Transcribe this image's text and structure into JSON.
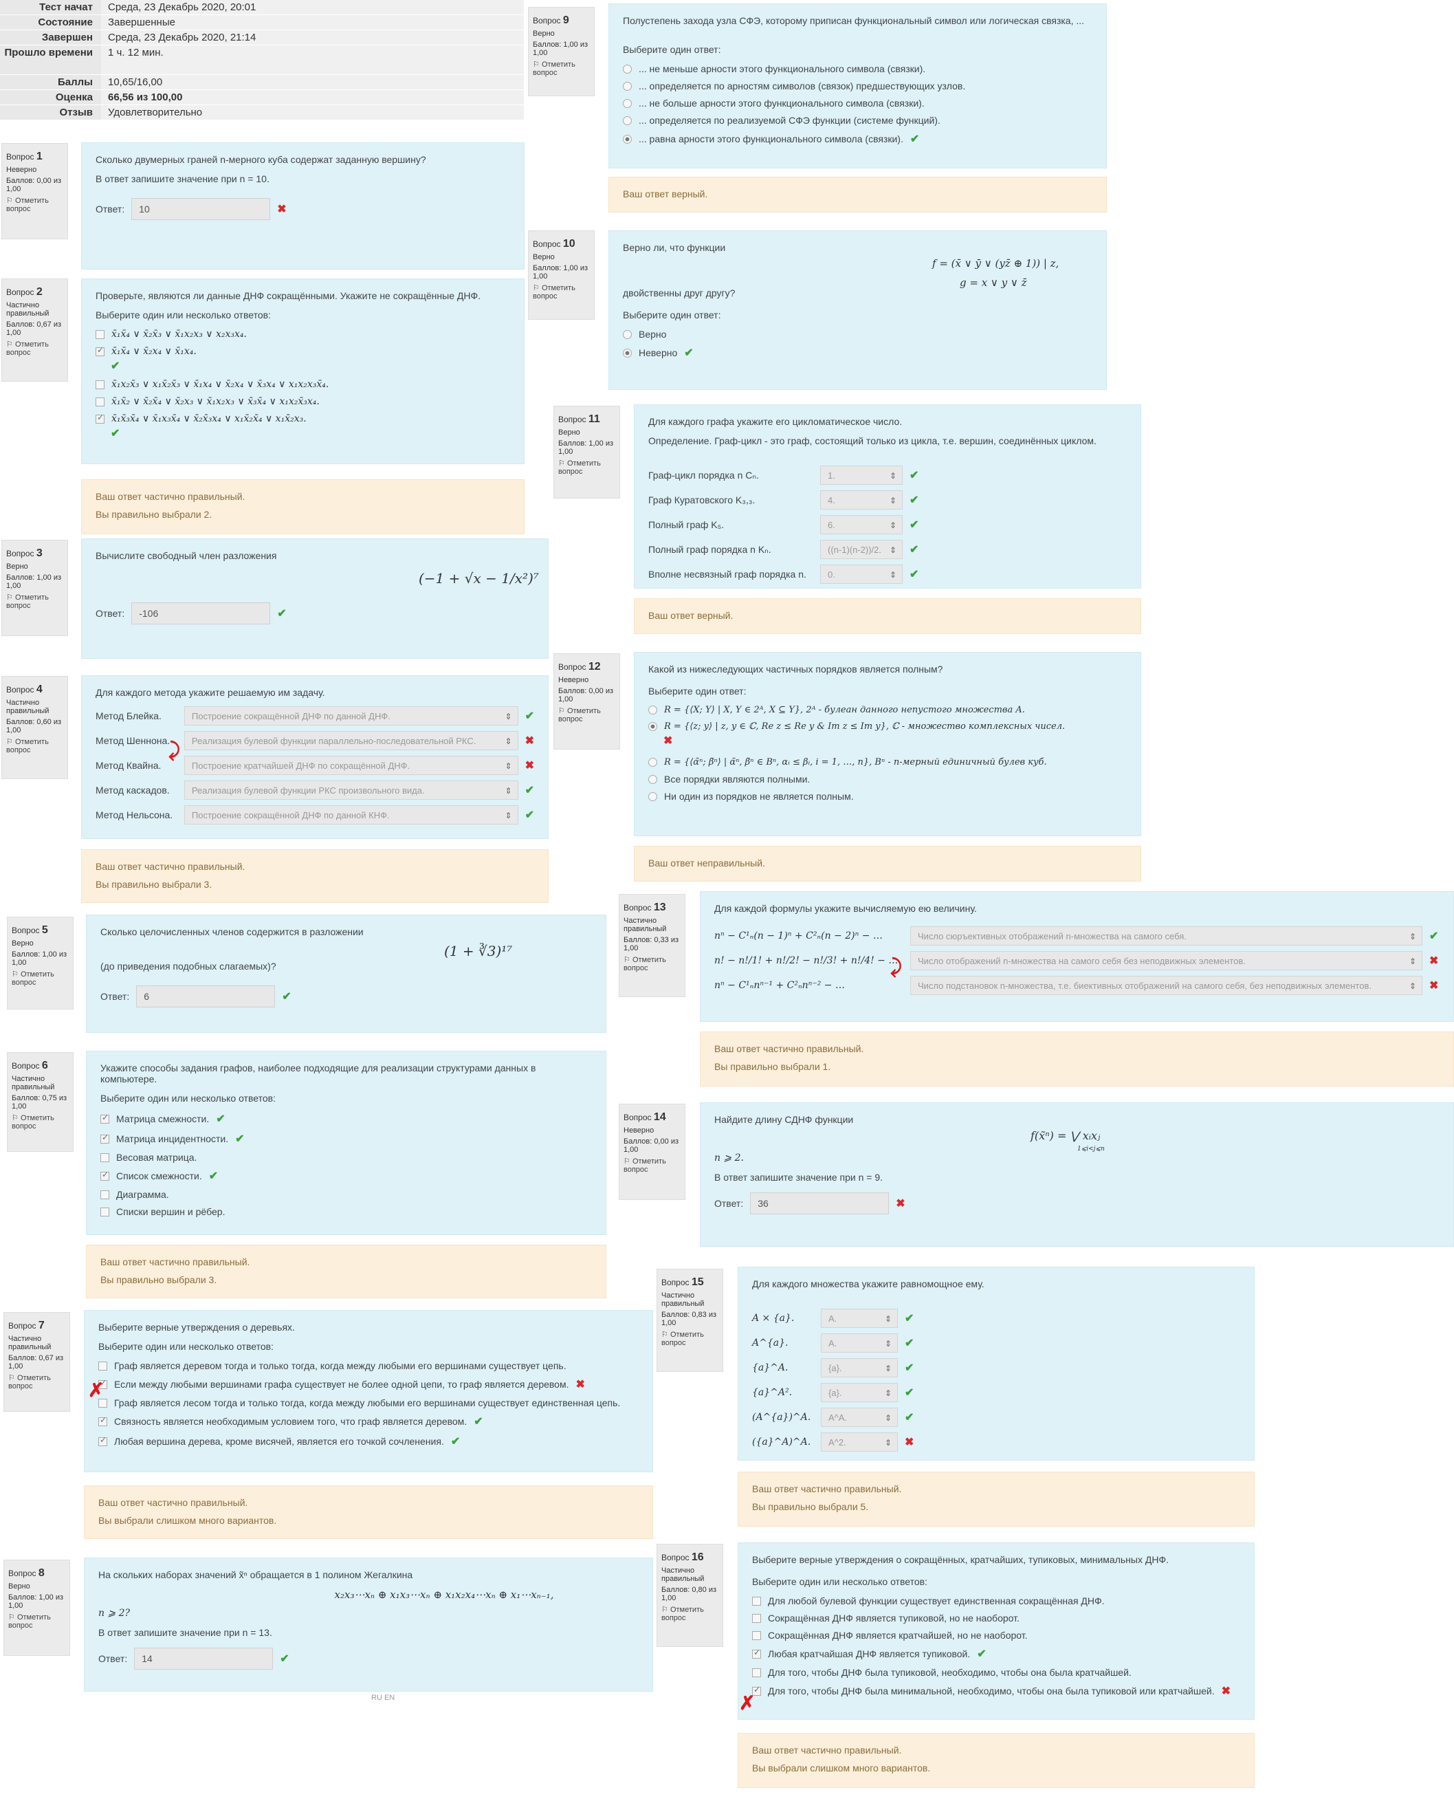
{
  "summary": [
    {
      "k": "Тест начат",
      "v": "Среда, 23 Декабрь 2020, 20:01"
    },
    {
      "k": "Состояние",
      "v": "Завершенные"
    },
    {
      "k": "Завершен",
      "v": "Среда, 23 Декабрь 2020, 21:14"
    },
    {
      "k": "Прошло времени",
      "v": "1 ч. 12 мин."
    },
    {
      "k": "Баллы",
      "v": "10,65/16,00"
    },
    {
      "k": "Оценка",
      "v": "66,56 из 100,00"
    },
    {
      "k": "Отзыв",
      "v": "Удовлетворительно"
    }
  ],
  "flag_label": "Отметить вопрос",
  "answer_label": "Ответ:",
  "choose_one": "Выберите один ответ:",
  "choose_many": "Выберите один или несколько ответов:",
  "questions": {
    "q1": {
      "no": "1",
      "state": "Неверно",
      "score": "Баллов: 0,00 из 1,00",
      "text": "Сколько двумерных граней n-мерного куба содержат заданную вершину?",
      "text2": "В ответ запишите значение при n = 10.",
      "answer": "10"
    },
    "q2": {
      "no": "2",
      "state": "Частично правильный",
      "score": "Баллов: 0,67 из 1,00",
      "text": "Проверьте, являются ли данные ДНФ сокращёнными. Укажите не сокращённые ДНФ.",
      "options": [
        "x̄₁x̄₄ ∨ x̄₂x̄₃ ∨ x̄₁x₂x₃ ∨ x₂x₃x₄.",
        "x̄₁x̄₄ ∨ x̄₂x₄ ∨ x̄₁x₄.",
        "x̄₁x₂x̄₃ ∨ x₁x̄₂x̄₃ ∨ x̄₁x₄ ∨ x̄₂x₄ ∨ x̄₃x₄ ∨ x₁x₂x₃x̄₄.",
        "x̄₁x̄₂ ∨ x̄₂x̄₄ ∨ x̄₂x₃ ∨ x̄₁x₂x₃ ∨ x̄₃x̄₄ ∨ x₁x₂x̄₃x₄.",
        "x̄₁x̄₃x̄₄ ∨ x̄₁x₃x̄₄ ∨ x̄₂x̄₃x₄ ∨ x₁x̄₂x̄₄ ∨ x₁x̄₂x₃."
      ],
      "fb1": "Ваш ответ частично правильный.",
      "fb2": "Вы правильно выбрали 2."
    },
    "q3": {
      "no": "3",
      "state": "Верно",
      "score": "Баллов: 1,00 из 1,00",
      "text": "Вычислите свободный член разложения",
      "formula": "(−1 + √x − 1/x²)⁷",
      "answer": "-106"
    },
    "q4": {
      "no": "4",
      "state": "Частично правильный",
      "score": "Баллов: 0,60 из 1,00",
      "text": "Для каждого метода укажите решаемую им задачу.",
      "rows": [
        {
          "label": "Метод Блейка.",
          "value": "Построение сокращённой ДНФ по данной ДНФ.",
          "ok": true
        },
        {
          "label": "Метод Шеннона.",
          "value": "Реализация булевой функции параллельно-последовательной РКС.",
          "ok": false
        },
        {
          "label": "Метод Квайна.",
          "value": "Построение кратчайшей ДНФ по сокращённой ДНФ.",
          "ok": false
        },
        {
          "label": "Метод каскадов.",
          "value": "Реализация булевой функции РКС произвольного вида.",
          "ok": true
        },
        {
          "label": "Метод Нельсона.",
          "value": "Построение сокращённой ДНФ по данной КНФ.",
          "ok": true
        }
      ],
      "fb1": "Ваш ответ частично правильный.",
      "fb2": "Вы правильно выбрали 3."
    },
    "q5": {
      "no": "5",
      "state": "Верно",
      "score": "Баллов: 1,00 из 1,00",
      "text": "Сколько целочисленных членов содержится в разложении",
      "formula": "(1 + ∛3)¹⁷",
      "text2": "(до приведения подобных слагаемых)?",
      "answer": "6"
    },
    "q6": {
      "no": "6",
      "state": "Частично правильный",
      "score": "Баллов: 0,75 из 1,00",
      "text": "Укажите способы задания графов, наиболее подходящие для реализации структурами данных в компьютере.",
      "options": [
        "Матрица смежности.",
        "Матрица инцидентности.",
        "Весовая матрица.",
        "Список смежности.",
        "Диаграмма.",
        "Списки вершин и рёбер."
      ],
      "fb1": "Ваш ответ частично правильный.",
      "fb2": "Вы правильно выбрали 3."
    },
    "q7": {
      "no": "7",
      "state": "Частично правильный",
      "score": "Баллов: 0,67 из 1,00",
      "text": "Выберите верные утверждения о деревьях.",
      "options": [
        "Граф является деревом тогда и только тогда, когда между любыми его вершинами существует цепь.",
        "Если между любыми вершинами графа существует не более одной цепи, то граф является деревом.",
        "Граф является лесом тогда и только тогда, когда между любыми его вершинами существует единственная цепь.",
        "Связность является необходимым условием того, что граф является деревом.",
        "Любая вершина дерева, кроме висячей, является его точкой сочленения."
      ],
      "fb1": "Ваш ответ частично правильный.",
      "fb2": "Вы выбрали слишком много вариантов."
    },
    "q8": {
      "no": "8",
      "state": "Верно",
      "score": "Баллов: 1,00 из 1,00",
      "text": "На скольких наборах значений x̃ⁿ обращается в 1 полином Жегалкина",
      "formula": "x₂x₃⋯xₙ ⊕ x₁x₃⋯xₙ ⊕ x₁x₂x₄⋯xₙ ⊕ x₁⋯xₙ₋₁,",
      "text2": "n ⩾ 2?",
      "text3": "В ответ запишите значение при n = 13.",
      "answer": "14"
    },
    "q9": {
      "no": "9",
      "state": "Верно",
      "score": "Баллов: 1,00 из 1,00",
      "text": "Полустепень захода узла СФЭ, которому приписан функциональный символ или логическая связка, ...",
      "options": [
        "... не меньше арности этого функционального символа (связки).",
        "... определяется по арностям символов (связок) предшествующих узлов.",
        "... не больше арности этого функционального символа (связки).",
        "... определяется по реализуемой СФЭ функции (системе функций).",
        "... равна арности этого функционального символа (связки)."
      ],
      "fb1": "Ваш ответ верный."
    },
    "q10": {
      "no": "10",
      "state": "Верно",
      "score": "Баллов: 1,00 из 1,00",
      "text": "Верно ли, что функции",
      "f1": "f = (x̄ ∨ ȳ ∨ (yz̄ ⊕ 1)) | z,",
      "f2": "g = x ∨ y ∨ z̄",
      "text2": "двойственны друг другу?",
      "options": [
        "Верно",
        "Неверно"
      ]
    },
    "q11": {
      "no": "11",
      "state": "Верно",
      "score": "Баллов: 1,00 из 1,00",
      "text": "Для каждого графа укажите его цикломатическое число.",
      "text2": "Определение. Граф-цикл - это граф, состоящий только из цикла, т.е. вершин, соединённых циклом.",
      "rows": [
        {
          "label": "Граф-цикл порядка n Cₙ.",
          "value": "1."
        },
        {
          "label": "Граф Куратовского K₃,₃.",
          "value": "4."
        },
        {
          "label": "Полный граф K₅.",
          "value": "6."
        },
        {
          "label": "Полный граф порядка n Kₙ.",
          "value": "((n-1)(n-2))/2."
        },
        {
          "label": "Вполне несвязный граф порядка n.",
          "value": "0."
        }
      ],
      "fb1": "Ваш ответ верный."
    },
    "q12": {
      "no": "12",
      "state": "Неверно",
      "score": "Баллов: 0,00 из 1,00",
      "text": "Какой из нижеследующих частичных порядков является полным?",
      "options": [
        "R = {⟨X; Y⟩ | X, Y ∈ 2ᴬ, X ⊆ Y}, 2ᴬ - булеан данного непустого множества A.",
        "R = {⟨z; y⟩ | z, y ∈ ℂ, Re z ≤ Re y & Im z ≤ Im y}, ℂ - множество комплексных чисел.",
        "R = {⟨α̃ⁿ; β̃ⁿ⟩ | α̃ⁿ, β̃ⁿ ∈ Bⁿ, αᵢ ≤ βᵢ, i = 1, …, n}, Bⁿ - n-мерный единичный булев куб.",
        "Все порядки являются полными.",
        "Ни один из порядков не является полным."
      ],
      "fb1": "Ваш ответ неправильный."
    },
    "q13": {
      "no": "13",
      "state": "Частично правильный",
      "score": "Баллов: 0,33 из 1,00",
      "text": "Для каждой формулы укажите вычисляемую ею величину.",
      "rows": [
        {
          "label": "nⁿ − C¹ₙ(n − 1)ⁿ + C²ₙ(n − 2)ⁿ − …",
          "value": "Число сюръективных отображений n-множества на самого себя.",
          "ok": true
        },
        {
          "label": "n! − n!/1! + n!/2! − n!/3! + n!/4! − …",
          "value": "Число отображений n-множества на самого себя без неподвижных элементов.",
          "ok": false
        },
        {
          "label": "nⁿ − C¹ₙnⁿ⁻¹ + C²ₙnⁿ⁻² − …",
          "value": "Число подстановок n-множества, т.е. биективных отображений на самого себя, без неподвижных элементов.",
          "ok": false
        }
      ],
      "fb1": "Ваш ответ частично правильный.",
      "fb2": "Вы правильно выбрали 1."
    },
    "q14": {
      "no": "14",
      "state": "Неверно",
      "score": "Баллов: 0,00 из 1,00",
      "text": "Найдите длину СДНФ функции",
      "formula": "f(x̃ⁿ) = ⋁ xᵢxⱼ",
      "formula_sub": "1⩽i<j⩽n",
      "text2": "n ⩾ 2.",
      "text3": "В ответ запишите значение при n = 9.",
      "answer": "36"
    },
    "q15": {
      "no": "15",
      "state": "Частично правильный",
      "score": "Баллов: 0,83 из 1,00",
      "text": "Для каждого множества укажите равномощное ему.",
      "rows": [
        {
          "label": "A × {a}.",
          "value": "A.",
          "ok": true
        },
        {
          "label": "A^{a}.",
          "value": "A.",
          "ok": true
        },
        {
          "label": "{a}^A.",
          "value": "{a}.",
          "ok": true
        },
        {
          "label": "{a}^A².",
          "value": "{a}.",
          "ok": true
        },
        {
          "label": "(A^{a})^A.",
          "value": "A^A.",
          "ok": true
        },
        {
          "label": "({a}^A)^A.",
          "value": "A^2.",
          "ok": false
        }
      ],
      "fb1": "Ваш ответ частично правильный.",
      "fb2": "Вы правильно выбрали 5."
    },
    "q16": {
      "no": "16",
      "state": "Частично правильный",
      "score": "Баллов: 0,80 из 1,00",
      "text": "Выберите верные утверждения о сокращённых, кратчайших, тупиковых, минимальных ДНФ.",
      "options": [
        "Для любой булевой функции существует единственная сокращённая ДНФ.",
        "Сокращённая ДНФ является тупиковой, но не наоборот.",
        "Сокращённая ДНФ является кратчайшей, но не наоборот.",
        "Любая кратчайшая ДНФ является тупиковой.",
        "Для того, чтобы ДНФ была тупиковой, необходимо, чтобы она была кратчайшей.",
        "Для того, чтобы ДНФ была минимальной, необходимо, чтобы она была тупиковой или кратчайшей."
      ],
      "fb1": "Ваш ответ частично правильный.",
      "fb2": "Вы выбрали слишком много вариантов."
    }
  },
  "lang_switch": "RU  EN",
  "colors": {
    "question_bg": "#def2f8",
    "feedback_bg": "#fcefdc",
    "info_bg": "#ebebeb",
    "correct": "#3aa13a",
    "incorrect": "#d9292b"
  }
}
